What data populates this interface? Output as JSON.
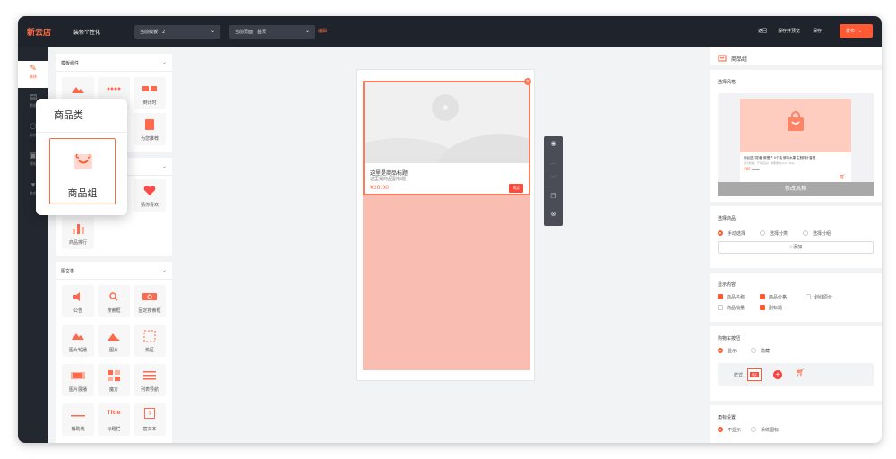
{
  "topbar": {
    "logo": "新云店",
    "title": "装修个性化",
    "template_select": "当前模板：2",
    "page_select": "当前页面：首页",
    "edit_link": "编辑",
    "back": "返回",
    "save_preview": "保存并预览",
    "save": "保存",
    "publish": "发布"
  },
  "left_nav": {
    "items": [
      {
        "label": "装修",
        "icon": "brush-icon"
      },
      {
        "label": "数据",
        "icon": "document-icon"
      },
      {
        "label": "导航",
        "icon": "nav-icon"
      },
      {
        "label": "模板",
        "icon": "template-icon"
      },
      {
        "label": "其他",
        "icon": "filter-icon"
      }
    ]
  },
  "components": {
    "template_section": {
      "title": "模板组件",
      "items": [
        {
          "label": "",
          "icon": "image-icon"
        },
        {
          "label": "",
          "icon": "dots-icon"
        },
        {
          "label": "倒计时",
          "icon": "countdown-icon"
        },
        {
          "label": "为您推荐",
          "icon": "recommend-icon"
        }
      ]
    },
    "product_section": {
      "items": [
        {
          "label": "猜你喜欢",
          "icon": "heart-icon"
        },
        {
          "label": "商品排行",
          "icon": "rank-icon"
        }
      ]
    },
    "graphic_section": {
      "title": "图文类",
      "items": [
        {
          "label": "公告",
          "icon": "speaker-icon"
        },
        {
          "label": "搜索框",
          "icon": "search-icon"
        },
        {
          "label": "固定搜索框",
          "icon": "search-icon"
        },
        {
          "label": "图片轮播",
          "icon": "carousel-icon"
        },
        {
          "label": "图片",
          "icon": "picture-icon"
        },
        {
          "label": "热区",
          "icon": "hotzone-icon"
        },
        {
          "label": "图片展播",
          "icon": "gallery-icon"
        },
        {
          "label": "魔方",
          "icon": "cube-icon"
        },
        {
          "label": "列表导航",
          "icon": "list-icon"
        },
        {
          "label": "辅助线",
          "icon": "line-icon"
        },
        {
          "label": "标题栏",
          "icon": "title-icon",
          "glyph": "Title"
        },
        {
          "label": "富文本",
          "icon": "richtext-icon",
          "glyph": "T"
        }
      ]
    }
  },
  "popup": {
    "title": "商品类",
    "item_label": "商品组"
  },
  "preview": {
    "product_title": "这里是商品标题",
    "product_subtitle": "这里是商品副标题",
    "price": "¥20.00",
    "buy_button": "购买"
  },
  "right_panel": {
    "header": "商品组",
    "style_section": {
      "label": "选择风格",
      "sample_title": "雨谷进口奶糖 鲜橙子 0个装 鲜味水果 生鲜榨汁香橙",
      "sample_sub": "官方旗舰，产地直采！单果重约120-160g",
      "sample_price": "¥89",
      "sample_old_price": "¥ 120",
      "modify_button": "修改风格"
    },
    "goods_section": {
      "label": "选择商品",
      "options": [
        "手动选择",
        "选择分类",
        "选择分组"
      ],
      "add_button": "+添加"
    },
    "display_section": {
      "label": "显示内容",
      "checks": [
        {
          "label": "商品名称",
          "checked": true
        },
        {
          "label": "商品价格",
          "checked": true
        },
        {
          "label": "划线原价",
          "checked": false
        },
        {
          "label": "商品销量",
          "checked": false
        },
        {
          "label": "副标题",
          "checked": true
        }
      ]
    },
    "cart_section": {
      "label": "购物车按钮",
      "options": [
        "显示",
        "隐藏"
      ],
      "style_label": "样式",
      "style_tag": "购买"
    },
    "badge_section": {
      "label": "角标设置",
      "options": [
        "不显示",
        "系统图标"
      ]
    }
  },
  "colors": {
    "accent": "#ff5a34",
    "pink": "#f9bdb1",
    "dark": "#1f232b"
  }
}
